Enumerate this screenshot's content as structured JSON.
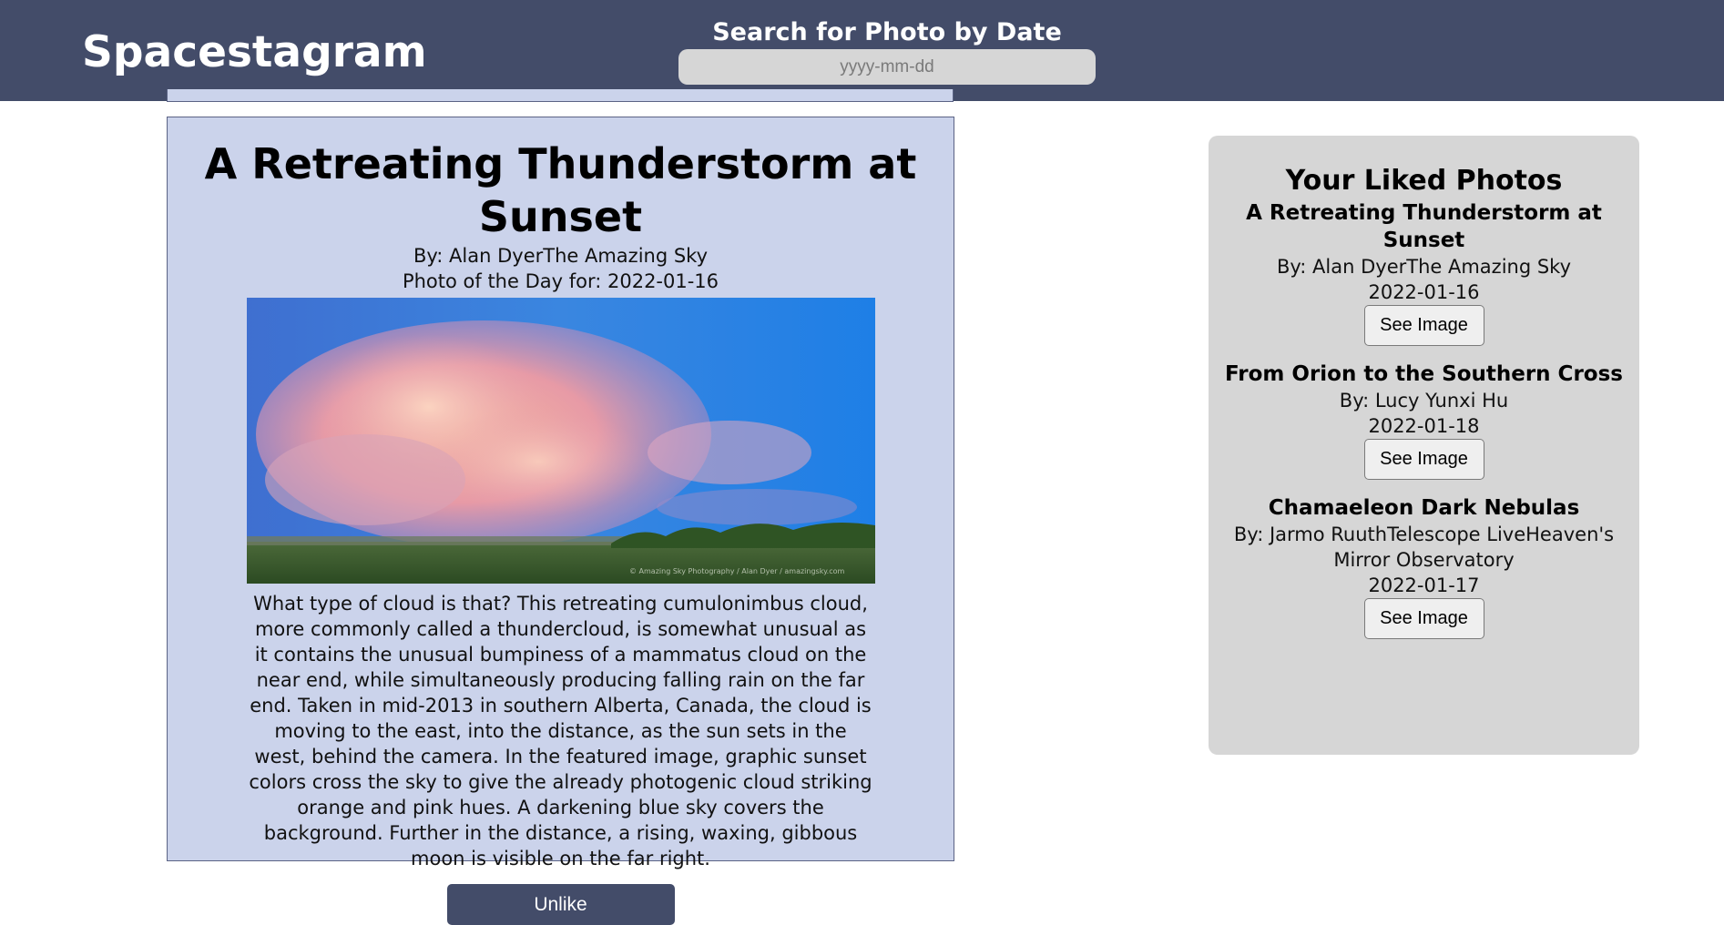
{
  "header": {
    "brand": "Spacestagram",
    "search_title": "Search for Photo by Date",
    "search_placeholder": "yyyy-mm-dd",
    "search_value": ""
  },
  "photo": {
    "title": "A Retreating Thunderstorm at Sunset",
    "by": "By: Alan DyerThe Amazing Sky",
    "date_line": "Photo of the Day for: 2022-01-16",
    "image_watermark": "© Amazing Sky Photography / Alan Dyer / amazingsky.com",
    "description": "What type of cloud is that? This retreating cumulonimbus cloud, more commonly called a thundercloud, is somewhat unusual as it contains the unusual bumpiness of a mammatus cloud on the near end, while simultaneously producing falling rain on the far end. Taken in mid-2013 in southern Alberta, Canada, the cloud is moving to the east, into the distance, as the sun sets in the west, behind the camera. In the featured image, graphic sunset colors cross the sky to give the already photogenic cloud striking orange and pink hues. A darkening blue sky covers the background. Further in the distance, a rising, waxing, gibbous moon is visible on the far right.",
    "unlike_label": "Unlike"
  },
  "liked": {
    "heading": "Your Liked Photos",
    "items": [
      {
        "title": "A Retreating Thunderstorm at Sunset",
        "by": "By: Alan DyerThe Amazing Sky",
        "date": "2022-01-16",
        "button": "See Image"
      },
      {
        "title": "From Orion to the Southern Cross",
        "by": "By: Lucy Yunxi Hu",
        "date": "2022-01-18",
        "button": "See Image"
      },
      {
        "title": "Chamaeleon Dark Nebulas",
        "by": "By: Jarmo RuuthTelescope LiveHeaven's Mirror Observatory",
        "date": "2022-01-17",
        "button": "See Image"
      }
    ]
  },
  "colors": {
    "header_bg": "#434c69",
    "card_bg": "#cbd3eb",
    "panel_bg": "#d6d6d6",
    "button_dark": "#434c69"
  }
}
